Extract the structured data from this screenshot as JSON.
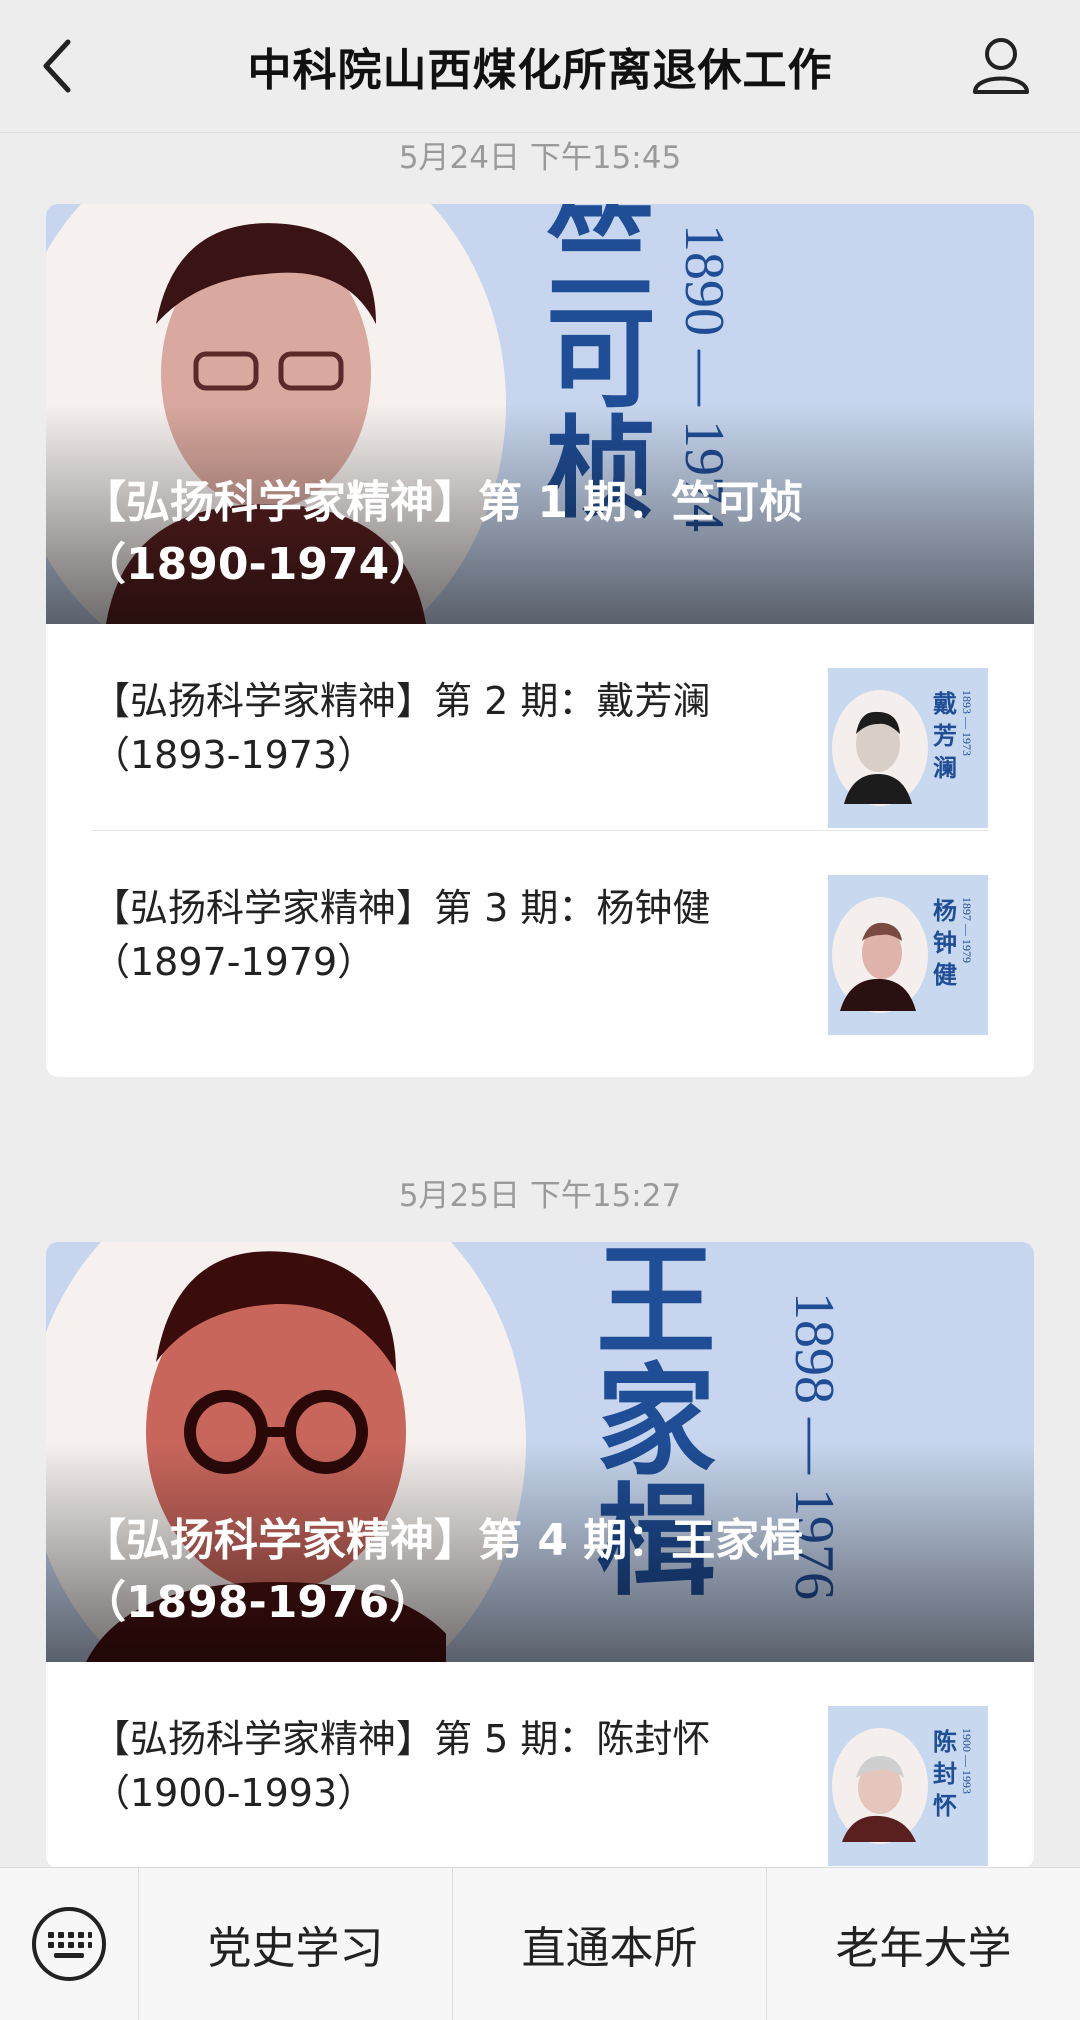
{
  "header": {
    "title": "中科院山西煤化所离退休工作"
  },
  "groups": [
    {
      "timestamp": "5月24日 下午15:45",
      "cover": {
        "title_line1": "【弘扬科学家精神】第 1 期：竺可桢",
        "title_line2": "（1890-1974）",
        "big_name": "竺可桢",
        "years": "1890 — 1974"
      },
      "items": [
        {
          "title_line1": "【弘扬科学家精神】第 2 期：戴芳澜",
          "title_line2": "（1893-1973）",
          "thumb_name": "戴芳澜",
          "thumb_years": "1893 — 1973"
        },
        {
          "title_line1": "【弘扬科学家精神】第 3 期：杨钟健",
          "title_line2": "（1897-1979）",
          "thumb_name": "杨钟健",
          "thumb_years": "1897 — 1979"
        }
      ]
    },
    {
      "timestamp": "5月25日 下午15:27",
      "cover": {
        "title_line1": "【弘扬科学家精神】第 4 期：王家楫",
        "title_line2": "（1898-1976）",
        "big_name": "王家楫",
        "years": "1898 — 1976"
      },
      "items": [
        {
          "title_line1": "【弘扬科学家精神】第 5 期：陈封怀",
          "title_line2": "（1900-1993）",
          "thumb_name": "陈封怀",
          "thumb_years": "1900 — 1993"
        }
      ]
    }
  ],
  "bottom_menu": {
    "keyboard_icon": "keyboard-icon",
    "items": [
      "党史学习",
      "直通本所",
      "老年大学"
    ]
  },
  "colors": {
    "background": "#ededed",
    "accent_blue": "#1f4d96",
    "cover_blue": "#c7d6ee"
  }
}
